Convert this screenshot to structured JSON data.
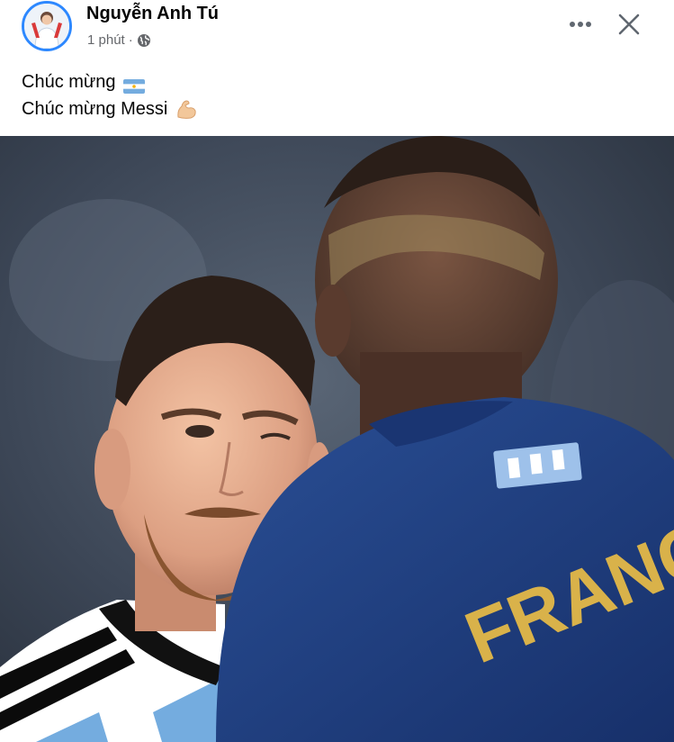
{
  "post": {
    "author": "Nguyễn Anh Tú",
    "time": "1 phút",
    "separator": "·",
    "privacy_icon": "globe-icon",
    "lines": [
      {
        "text": "Chúc mừng",
        "emoji": "argentina-flag-icon"
      },
      {
        "text": "Chúc mừng Messi",
        "emoji": "flexed-biceps-icon"
      }
    ]
  },
  "controls": {
    "more_icon": "more-horizontal-icon",
    "close_icon": "close-icon"
  },
  "photo": {
    "jersey_text": "FRANC"
  },
  "colors": {
    "accent": "#2d88ff",
    "secondary_text": "#65676b",
    "jersey_blue": "#1f3f7e",
    "jersey_lettering": "#d9b24a"
  }
}
